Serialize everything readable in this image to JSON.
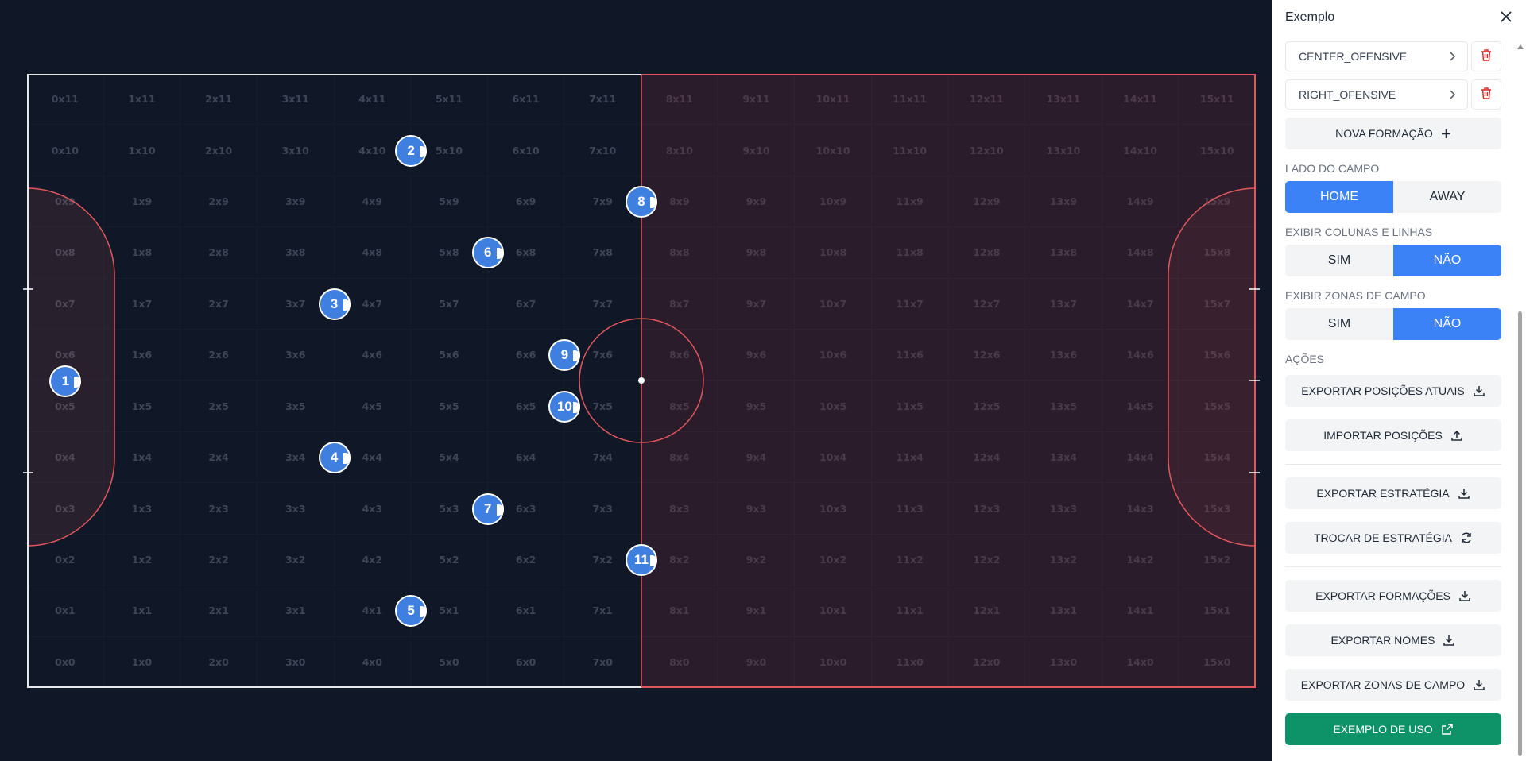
{
  "field": {
    "cols": 16,
    "rows": 12,
    "players": [
      {
        "number": "1",
        "col": 0,
        "row": 5.5
      },
      {
        "number": "2",
        "col": 4.5,
        "row": 10
      },
      {
        "number": "3",
        "col": 3.5,
        "row": 7
      },
      {
        "number": "4",
        "col": 3.5,
        "row": 4
      },
      {
        "number": "5",
        "col": 4.5,
        "row": 1
      },
      {
        "number": "6",
        "col": 5.5,
        "row": 8
      },
      {
        "number": "7",
        "col": 5.5,
        "row": 3
      },
      {
        "number": "8",
        "col": 7.5,
        "row": 9
      },
      {
        "number": "9",
        "col": 6.5,
        "row": 6
      },
      {
        "number": "10",
        "col": 6.5,
        "row": 5
      },
      {
        "number": "11",
        "col": 7.5,
        "row": 2
      }
    ],
    "colors": {
      "home_line": "#e5e7eb",
      "away_line": "#e0585b",
      "away_fill": "#2b1c2c",
      "player": "#3f7fe0"
    }
  },
  "sidebar": {
    "title": "Exemplo",
    "formations": [
      {
        "label": "CENTER_OFENSIVE"
      },
      {
        "label": "RIGHT_OFENSIVE"
      }
    ],
    "new_formation": "NOVA FORMAÇÃO",
    "side_label": "LADO DO CAMPO",
    "side_home": "HOME",
    "side_away": "AWAY",
    "side_selected": "HOME",
    "cols_label": "EXIBIR COLUNAS E LINHAS",
    "cols_yes": "SIM",
    "cols_no": "NÃO",
    "cols_selected": "NÃO",
    "zones_label": "EXIBIR ZONAS DE CAMPO",
    "zones_yes": "SIM",
    "zones_no": "NÃO",
    "zones_selected": "NÃO",
    "actions_label": "AÇÕES",
    "actions": {
      "export_positions": "EXPORTAR POSIÇÕES ATUAIS",
      "import_positions": "IMPORTAR POSIÇÕES",
      "export_strategy": "EXPORTAR ESTRATÉGIA",
      "switch_strategy": "TROCAR DE ESTRATÉGIA",
      "export_formations": "EXPORTAR FORMAÇÕES",
      "export_names": "EXPORTAR NOMES",
      "export_zones": "EXPORTAR ZONAS DE CAMPO",
      "usage_example": "EXEMPLO DE USO"
    },
    "colors": {
      "accent": "#3b82f6",
      "green": "#0e9268",
      "danger": "#dc2626"
    },
    "icons": {
      "close": "close-icon",
      "chevron": "chevron-right-icon",
      "trash": "trash-icon",
      "plus": "plus-icon",
      "download": "download-icon",
      "upload": "upload-icon",
      "refresh": "refresh-icon",
      "external": "external-link-icon"
    }
  }
}
